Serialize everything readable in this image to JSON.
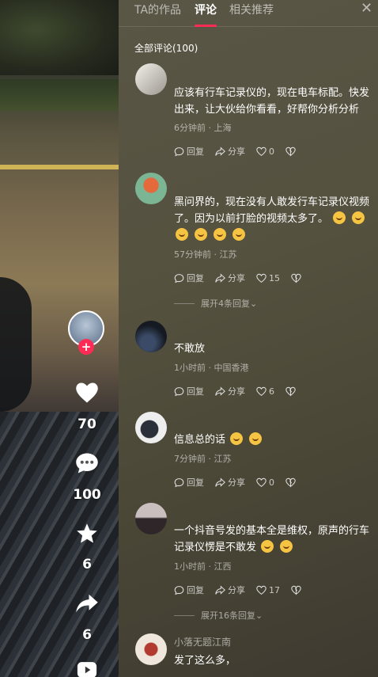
{
  "video": {
    "actions": {
      "like_count": "70",
      "comment_count": "100",
      "favorite_count": "6",
      "share_count": "6"
    }
  },
  "panel": {
    "tabs": [
      "TA的作品",
      "评论",
      "相关推荐"
    ],
    "active_tab": "评论",
    "all_comments_label": "全部评论(100)",
    "reply_label": "回复",
    "share_label": "分享"
  },
  "comments": [
    {
      "name": "",
      "text": "应该有行车记录仪的，现在电车标配。快发出来，让大伙给你看看，好帮你分析分析",
      "meta": "6分钟前 · 上海",
      "likes": "0",
      "avatar_color": "#e9e6e1"
    },
    {
      "name": "",
      "text": "黑问界的，现在没有人敢发行车记录仪视频了。因为以前打脸的视频太多了。",
      "meta": "57分钟前 · 江苏",
      "likes": "15",
      "expand": "展开4条回复",
      "avatar_color": "#6fae8a"
    },
    {
      "name": "",
      "text": "不敢放",
      "meta": "1小时前 · 中国香港",
      "likes": "6",
      "avatar_color": "#1f2530"
    },
    {
      "name": "",
      "text": "信息总的话",
      "meta": "7分钟前 · 江苏",
      "likes": "0",
      "avatar_color": "#f1f1f1"
    },
    {
      "name": "",
      "text": "一个抖音号发的基本全是维权，原声的行车记录仪愣是不敢发",
      "meta": "1小时前 · 江西",
      "likes": "17",
      "expand": "展开16条回复",
      "avatar_color": "#3a3032"
    },
    {
      "name": "小落无题江南",
      "text": "发了这么多，",
      "meta": "",
      "likes": "",
      "avatar_color": "#e9e2d8"
    }
  ],
  "colors": {
    "accent": "#fe2c55",
    "panel_bg": "#55513f"
  }
}
